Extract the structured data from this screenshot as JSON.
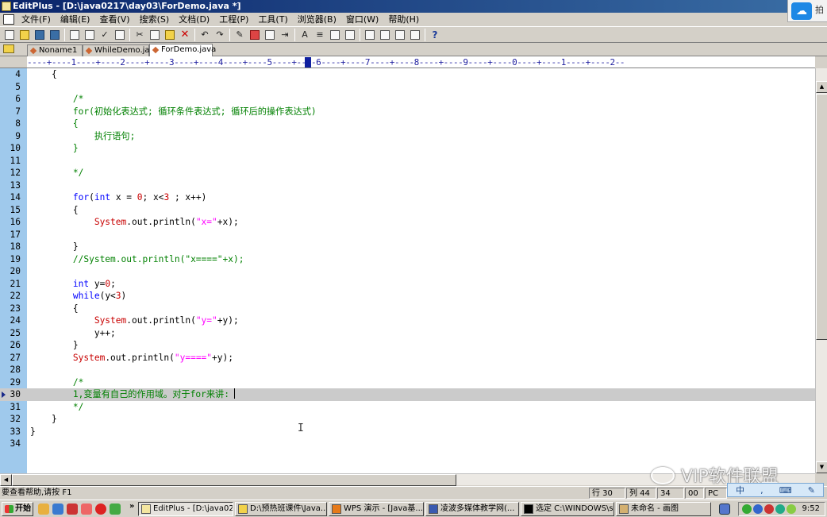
{
  "window": {
    "title": "EditPlus - [D:\\java0217\\day03\\ForDemo.java *]"
  },
  "menu": [
    "文件(F)",
    "编辑(E)",
    "查看(V)",
    "搜索(S)",
    "文档(D)",
    "工程(P)",
    "工具(T)",
    "浏览器(B)",
    "窗口(W)",
    "帮助(H)"
  ],
  "corner_badge": {
    "extra": "拍"
  },
  "tabs": [
    "Noname1",
    "WhileDemo.java",
    "ForDemo.java"
  ],
  "ruler": "----+----1----+----2----+----3----+----4----+----5----+----6----+----7----+----8----+----9----+----0----+----1----+----2--",
  "code": [
    {
      "n": "4",
      "indent": "    ",
      "parts": [
        {
          "t": "{",
          "c": "black"
        }
      ]
    },
    {
      "n": "5",
      "indent": "",
      "parts": []
    },
    {
      "n": "6",
      "indent": "        ",
      "parts": [
        {
          "t": "/*",
          "c": "green"
        }
      ]
    },
    {
      "n": "7",
      "indent": "        ",
      "parts": [
        {
          "t": "for(初始化表达式; 循环条件表达式; 循环后的操作表达式)",
          "c": "green"
        }
      ]
    },
    {
      "n": "8",
      "indent": "        ",
      "parts": [
        {
          "t": "{",
          "c": "green"
        }
      ]
    },
    {
      "n": "9",
      "indent": "            ",
      "parts": [
        {
          "t": "执行语句;",
          "c": "green"
        }
      ]
    },
    {
      "n": "10",
      "indent": "        ",
      "parts": [
        {
          "t": "}",
          "c": "green"
        }
      ]
    },
    {
      "n": "11",
      "indent": "",
      "parts": []
    },
    {
      "n": "12",
      "indent": "        ",
      "parts": [
        {
          "t": "*/",
          "c": "green"
        }
      ]
    },
    {
      "n": "13",
      "indent": "",
      "parts": []
    },
    {
      "n": "14",
      "indent": "        ",
      "parts": [
        {
          "t": "for",
          "c": "blue"
        },
        {
          "t": "(",
          "c": "black"
        },
        {
          "t": "int",
          "c": "blue"
        },
        {
          "t": " x = ",
          "c": "black"
        },
        {
          "t": "0",
          "c": "red"
        },
        {
          "t": "; x<",
          "c": "black"
        },
        {
          "t": "3",
          "c": "red"
        },
        {
          "t": " ; x++)",
          "c": "black"
        }
      ]
    },
    {
      "n": "15",
      "indent": "        ",
      "parts": [
        {
          "t": "{",
          "c": "black"
        }
      ]
    },
    {
      "n": "16",
      "indent": "            ",
      "parts": [
        {
          "t": "System",
          "c": "red"
        },
        {
          "t": ".out.println(",
          "c": "black"
        },
        {
          "t": "\"x=\"",
          "c": "mag"
        },
        {
          "t": "+x);",
          "c": "black"
        }
      ]
    },
    {
      "n": "17",
      "indent": "",
      "parts": []
    },
    {
      "n": "18",
      "indent": "        ",
      "parts": [
        {
          "t": "}",
          "c": "black"
        }
      ]
    },
    {
      "n": "19",
      "indent": "        ",
      "parts": [
        {
          "t": "//System.out.println(\"x====\"+x);",
          "c": "green"
        }
      ]
    },
    {
      "n": "20",
      "indent": "",
      "parts": []
    },
    {
      "n": "21",
      "indent": "        ",
      "parts": [
        {
          "t": "int",
          "c": "blue"
        },
        {
          "t": " y=",
          "c": "black"
        },
        {
          "t": "0",
          "c": "red"
        },
        {
          "t": ";",
          "c": "black"
        }
      ]
    },
    {
      "n": "22",
      "indent": "        ",
      "parts": [
        {
          "t": "while",
          "c": "blue"
        },
        {
          "t": "(y<",
          "c": "black"
        },
        {
          "t": "3",
          "c": "red"
        },
        {
          "t": ")",
          "c": "black"
        }
      ]
    },
    {
      "n": "23",
      "indent": "        ",
      "parts": [
        {
          "t": "{",
          "c": "black"
        }
      ]
    },
    {
      "n": "24",
      "indent": "            ",
      "parts": [
        {
          "t": "System",
          "c": "red"
        },
        {
          "t": ".out.println(",
          "c": "black"
        },
        {
          "t": "\"y=\"",
          "c": "mag"
        },
        {
          "t": "+y);",
          "c": "black"
        }
      ]
    },
    {
      "n": "25",
      "indent": "            ",
      "parts": [
        {
          "t": "y++;",
          "c": "black"
        }
      ]
    },
    {
      "n": "26",
      "indent": "        ",
      "parts": [
        {
          "t": "}",
          "c": "black"
        }
      ]
    },
    {
      "n": "27",
      "indent": "        ",
      "parts": [
        {
          "t": "System",
          "c": "red"
        },
        {
          "t": ".out.println(",
          "c": "black"
        },
        {
          "t": "\"y====\"",
          "c": "mag"
        },
        {
          "t": "+y);",
          "c": "black"
        }
      ]
    },
    {
      "n": "28",
      "indent": "",
      "parts": []
    },
    {
      "n": "29",
      "indent": "        ",
      "parts": [
        {
          "t": "/*",
          "c": "green"
        }
      ]
    },
    {
      "n": "30",
      "indent": "        ",
      "parts": [
        {
          "t": "1,变量有自己的作用域。对于for来讲:",
          "c": "green"
        }
      ],
      "current": true
    },
    {
      "n": "31",
      "indent": "        ",
      "parts": [
        {
          "t": "*/",
          "c": "green"
        }
      ]
    },
    {
      "n": "32",
      "indent": "    ",
      "parts": [
        {
          "t": "}",
          "c": "black"
        }
      ]
    },
    {
      "n": "33",
      "indent": "",
      "parts": [
        {
          "t": "}",
          "c": "black"
        }
      ]
    },
    {
      "n": "34",
      "indent": "",
      "parts": []
    }
  ],
  "colors": {
    "gutter": "#9fc9ec",
    "comment": "#008000",
    "keyword": "#0000ff",
    "number": "#c80000",
    "string": "#ff00ff",
    "current_line": "#cbcbcb"
  },
  "status": {
    "help": "要查看帮助,请按 F1",
    "line": "行 30",
    "col": "列 44",
    "total": "34",
    "mode": "00",
    "pc": "PC"
  },
  "watermark": "VIP软件联盟",
  "taskbar": {
    "start": "开始",
    "buttons": [
      "EditPlus - [D:\\java021...",
      "D:\\预热班课件\\Java...",
      "WPS 演示 - [Java基...",
      "凌波多媒体教学网(...",
      "选定 C:\\WINDOWS\\s...",
      "未命名 - 画图"
    ],
    "clock": "9:52"
  },
  "icons": {
    "toolbar": [
      "new-file-icon",
      "open-icon",
      "save-icon",
      "save-all-icon",
      "print-preview-icon",
      "print-icon",
      "spell-check-icon",
      "clipboard-icon",
      "cut-icon",
      "copy-icon",
      "paste-icon",
      "delete-icon",
      "undo-icon",
      "redo-icon",
      "find-icon",
      "replace-icon",
      "goto-icon",
      "column-icon",
      "font-icon",
      "wordwrap-icon",
      "ruler-icon",
      "line-number-icon",
      "window-icon",
      "tile-icon",
      "browser-icon",
      "preview-icon",
      "help-icon"
    ]
  }
}
